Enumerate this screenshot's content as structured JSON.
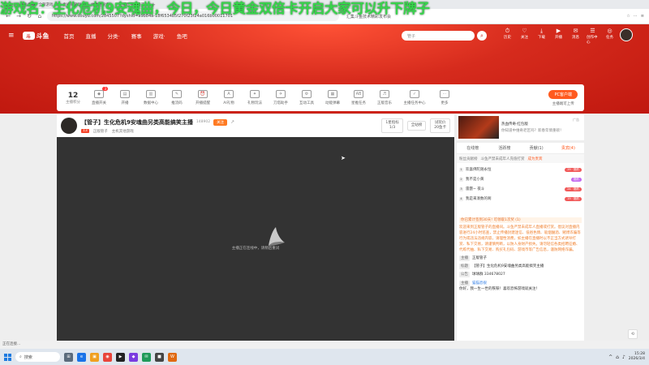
{
  "overlay_banner": "游戏名：生化危机9安魂曲，今日，今日黄金双倍卡开启大家可以升下牌子",
  "browser": {
    "tabs": [
      "斗鱼直播 - 全部游戏",
      "直播间管理",
      "抗衰老搜索",
      "正版营子主播开"
    ],
    "url": "https://www.douyu.com/2845507?dyshid=a9b84a-18f6534b5f270f23f24a016b00011701",
    "page_title": "汇集斗鱼技术精彩发布会",
    "back_glyph": "←",
    "forward_glyph": "→",
    "refresh_glyph": "↻",
    "home_glyph": "⌂",
    "new_tab_glyph": "+",
    "tools": [
      "☆",
      "⋯",
      "≡"
    ]
  },
  "site_nav": {
    "menu_glyph": "≡",
    "logo_mark": "斗",
    "logo_text": "斗鱼",
    "items": [
      "首页",
      "直播",
      "分类·",
      "赛事",
      "游戏·",
      "鱼吧"
    ],
    "search_placeholder": "管子",
    "search_glyph": "⌕",
    "user_tools": [
      {
        "icon": "⏱",
        "label": "历史"
      },
      {
        "icon": "♡",
        "label": "关注"
      },
      {
        "icon": "⤓",
        "label": "下载"
      },
      {
        "icon": "▶",
        "label": "开播"
      },
      {
        "icon": "✉",
        "label": "消息"
      },
      {
        "icon": "☰",
        "label": "创作中心"
      },
      {
        "icon": "◎",
        "label": "任务"
      }
    ]
  },
  "toolbar": {
    "level": "12",
    "level_label": "主播积分",
    "tools": [
      {
        "icon": "◆",
        "label": "直播开关",
        "badge": "3"
      },
      {
        "icon": "▤",
        "label": "开播",
        "badge": ""
      },
      {
        "icon": "▥",
        "label": "数据中心",
        "badge": ""
      },
      {
        "icon": "✎",
        "label": "推流码",
        "badge": ""
      },
      {
        "icon": "⏰",
        "label": "开播提醒",
        "badge": ""
      },
      {
        "icon": "A",
        "label": "AI礼物",
        "badge": ""
      },
      {
        "icon": "✦",
        "label": "礼物玩法",
        "badge": ""
      },
      {
        "icon": "✈",
        "label": "刀塔助手",
        "badge": ""
      },
      {
        "icon": "⚙",
        "label": "互动工具",
        "badge": ""
      },
      {
        "icon": "▦",
        "label": "动能弹幕",
        "badge": ""
      },
      {
        "icon": "AB",
        "label": "星推任务",
        "badge": ""
      },
      {
        "icon": "♬",
        "label": "正版音乐",
        "badge": ""
      },
      {
        "icon": "✓",
        "label": "主播任务中心",
        "badge": ""
      },
      {
        "icon": "⋯",
        "label": "更多",
        "badge": ""
      }
    ],
    "pc_client_label": "PC客户端",
    "pc_client_sub": "主播端可上传"
  },
  "room": {
    "title": "【管子】生化危机9安魂曲另类高能搞笑主播",
    "room_id": "148902",
    "follow_label": "关注",
    "share_glyph": "↗",
    "level_tag": "13",
    "streamer_name": "正版管子",
    "category": "主机其他游戏",
    "header_boxes": [
      {
        "l1": "1星指标",
        "l2": "1/3"
      },
      {
        "l1": "全站榜",
        "l2": ""
      },
      {
        "l1": "试玩价",
        "l2": "20鱼卡"
      }
    ]
  },
  "video": {
    "message": "主播正在连线中，请稍后重试",
    "cursor_glyph": "➤"
  },
  "sidebar": {
    "ad": {
      "title": "热血传奇·红包版",
      "desc": "你知道中维奇老区吗？新春年情重磅！",
      "tag": "广告"
    },
    "rank_tabs": [
      "在线榜",
      "活跃榜",
      "贡献(1)",
      "贵宾(4)"
    ],
    "rank_sub": [
      "粉丝贡献榜",
      "斗鱼严禁未成年人充值打赏",
      "成为贵宾"
    ],
    "rank_list": [
      {
        "num": "1",
        "name": "欢喜佛陀随永恒",
        "badge": "29 · 猎豹"
      },
      {
        "num": "2",
        "name": "我不是小黄",
        "badge": "猎豹"
      },
      {
        "num": "3",
        "name": "雷霆~ 夜斗",
        "badge": "24 · 猎豹"
      },
      {
        "num": "4",
        "name": "我是来凑数的啊",
        "badge": "19 · 猎豹"
      }
    ],
    "notice": "你已累计签到30天! 可领取1次奖 (1)",
    "welcome": "欢迎来到正版管子的直播间。斗鱼严禁未成年人直播或打赏。倡议对直播内容进行24小时巡查，禁止传播封建迷信、低俗色情、吸烟酗酒、赌博诈骗等行为或违法违规内容，请理性消费，如主播在直播时以不正当方式诱导打赏、私下交易，请谨慎判断，以防人身财产损失。请勿轻信各类招聘征婚、代练代抽、私下交易、购买礼包码、游戏币等广告信息，谨防网络诈骗。",
    "kv": [
      {
        "k": "主播",
        "v": "正版管子"
      },
      {
        "k": "标题",
        "v": "【管子】生化危机9安魂曲另类高能搞笑主播"
      },
      {
        "k": "公告",
        "v": "球球群 334678027"
      }
    ],
    "bot_tag": "主播",
    "bot_name": "猫猫恐很",
    "bot_msg": "你好，我一生一世的铁铁！喜欢恐怖游戏就关注！"
  },
  "side_float": [
    "⟲",
    "◎",
    "↑"
  ],
  "statusbar": "正在连接...",
  "taskbar": {
    "search_label": "搜索",
    "search_glyph": "⌕",
    "apps": [
      {
        "glyph": "⊞",
        "color": "#5b6b7c"
      },
      {
        "glyph": "e",
        "color": "#1a73e8"
      },
      {
        "glyph": "▣",
        "color": "#f0a020"
      },
      {
        "glyph": "◉",
        "color": "#e8443a"
      },
      {
        "glyph": "▶",
        "color": "#222222"
      },
      {
        "glyph": "◆",
        "color": "#7a3ce0"
      },
      {
        "glyph": "✉",
        "color": "#1f9a5a"
      },
      {
        "glyph": "■",
        "color": "#444444"
      },
      {
        "glyph": "W",
        "color": "#e06a12"
      }
    ],
    "tray": [
      "^",
      "⌂",
      "♪"
    ],
    "time": "15:28",
    "date": "2026/3/4"
  },
  "colors": {
    "accent": "#ff5a1f",
    "brand_red": "#c81f16",
    "overlay_green": "#36d54a"
  }
}
